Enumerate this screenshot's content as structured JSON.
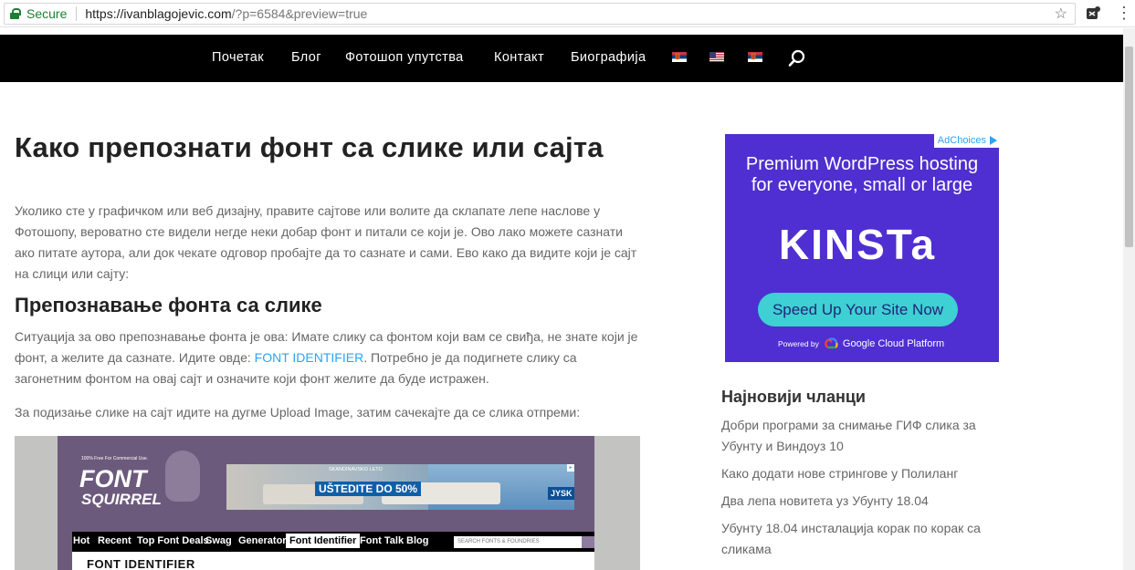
{
  "browser": {
    "secure_label": "Secure",
    "url_host": "https://ivanblagojevic.com",
    "url_rest": "/?p=6584&preview=true",
    "star_glyph": "☆",
    "menu_glyph": "⋮"
  },
  "nav": {
    "items": [
      "Почетак",
      "Блог",
      "Фотошоп упутства",
      "Контакт",
      "Биографија"
    ],
    "flags": [
      "serbian-flag",
      "us-flag",
      "serbian-flag"
    ]
  },
  "article": {
    "title": "Како препознати фонт са слике или сајта",
    "intro": "Уколико сте у графичком или веб дизајну, правите сајтове или волите да склапате лепе наслове у Фотошопу, вероватно сте видели негде неки добар фонт и питали се који је. Ово лако можете сазнати ако питате аутора, али док чекате одговор пробајте да то сазнате и сами. Ево како да видите који је сајт на слици или сајту:",
    "subheading": "Препознавање фонта са слике",
    "para2_before": "Ситуација за ово препознавање фонта је ова: Имате слику са фонтом који вам се свиђа, не знате који је фонт, а желите да сазнате. Идите овде: ",
    "para2_link": "FONT IDENTIFIER",
    "para2_after": ". Потребно је да подигнете слику са загонетним фонтом на овај сајт и означите који фонт желите да буде истражен.",
    "para3": "За подизање слике на сајт идите на дугме Upload Image, затим сачекајте да се слика отпреми:"
  },
  "embed": {
    "tagline": "100% Free For Commercial Use.",
    "logo_top": "FONT",
    "logo_bottom": "SQUIRREL",
    "banner_small": "SKANDINAVSKO LETO",
    "banner_big": "UŠTEDITE DO 50%",
    "banner_brand": "JYSK",
    "banner_ad_mark": "▸",
    "nav_items": [
      "Hot",
      "Recent",
      "Top Font Deals",
      "Swag",
      "Generator",
      "Font Identifier",
      "Font Talk",
      "Blog"
    ],
    "active_item": "Font Identifier",
    "search_placeholder": "SEARCH FONTS & FOUNDRIES",
    "heading": "FONT IDENTIFIER"
  },
  "ad": {
    "adchoices": "AdChoices",
    "line1": "Premium WordPress hosting",
    "line2": "for everyone, small or large",
    "logo": "KINSTa",
    "button": "Speed Up Your Site Now",
    "powered_by": "Powered by",
    "partner": "Google Cloud Platform",
    "background": "#4f2fd1",
    "button_color": "#3ed0d2"
  },
  "sidebar": {
    "recent_title": "Најновији чланци",
    "recent_posts": [
      "Добри програми за снимање ГИФ слика за Убунту и Виндоуз 10",
      "Како додати нове стрингове у Полиланг",
      "Два лепа новитета уз Убунту 18.04",
      "Убунту 18.04 инсталација корак по корак са сликама"
    ]
  },
  "colors": {
    "nav_bg": "#000000",
    "link": "#2ea3f2",
    "body_text": "#666666",
    "heading": "#222222"
  }
}
